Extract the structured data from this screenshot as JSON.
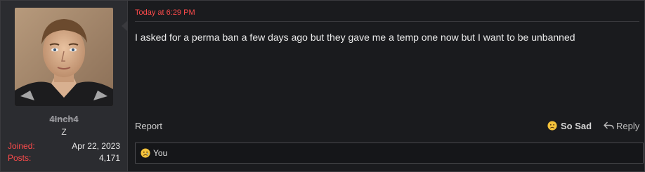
{
  "user": {
    "username": "4Inch4",
    "title": "Z",
    "stats": [
      {
        "label": "Joined:",
        "value": "Apr 22, 2023"
      },
      {
        "label": "Posts:",
        "value": "4,171"
      }
    ]
  },
  "post": {
    "timestamp": "Today at 6:29 PM",
    "message": "I asked for a perma ban a few days ago but they gave me a temp one now but I want to be unbanned"
  },
  "actions": {
    "report_label": "Report",
    "reaction_label": "So Sad",
    "reaction_icon": "sad-face-icon",
    "reply_label": "Reply",
    "reply_icon": "reply-arrow-icon"
  },
  "reactions_bar": {
    "icon": "sad-face-icon",
    "text": "You"
  },
  "colors": {
    "accent_red": "#ff4b4b",
    "background": "#1a1b1e",
    "sidebar": "#2b2c30"
  }
}
